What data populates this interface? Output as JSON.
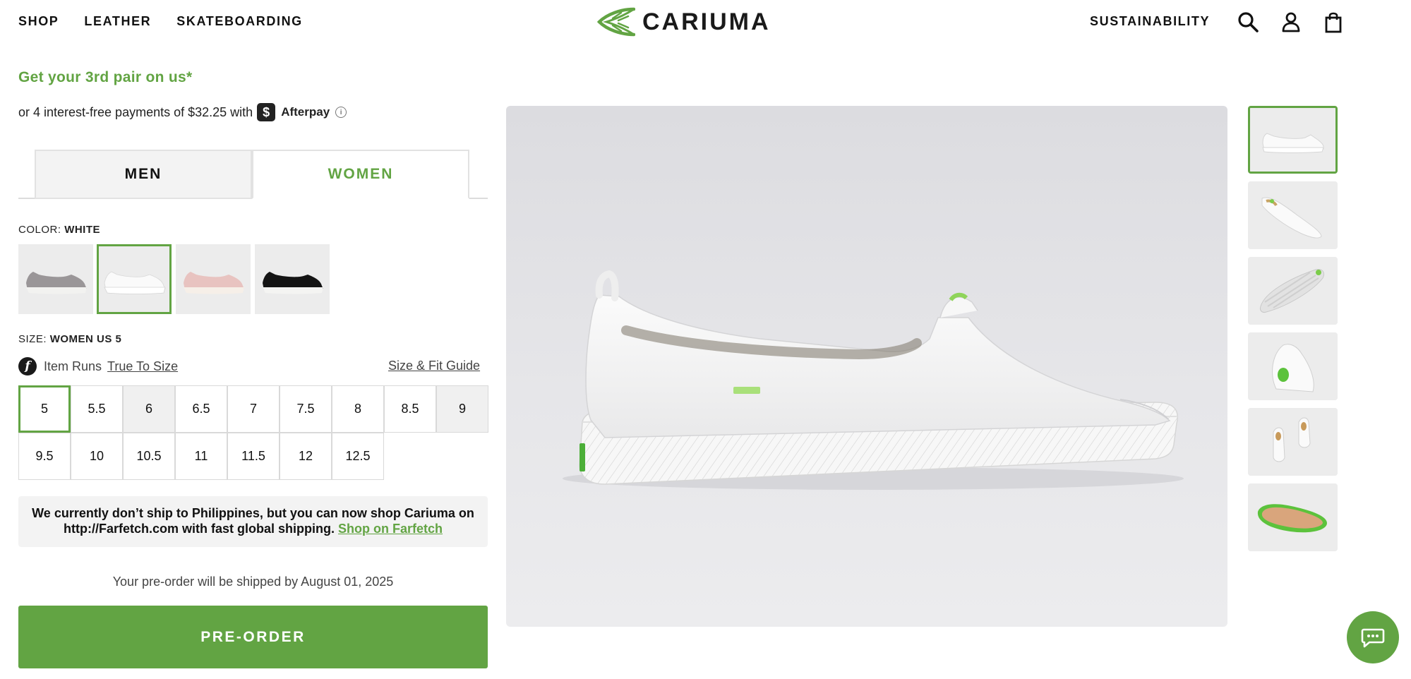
{
  "header": {
    "nav_left": [
      "SHOP",
      "LEATHER",
      "SKATEBOARDING"
    ],
    "brand": "CARIUMA",
    "nav_right": "SUSTAINABILITY",
    "icons": [
      "search-icon",
      "account-icon",
      "bag-icon"
    ]
  },
  "promo": "Get your 3rd pair on us*",
  "afterpay": {
    "text": "or 4 interest-free payments of $32.25 with",
    "badge": "$",
    "name": "Afterpay",
    "info": "i"
  },
  "gender_tabs": {
    "men": "MEN",
    "women": "WOMEN",
    "selected": "women"
  },
  "color": {
    "label": "COLOR:",
    "value": "WHITE",
    "swatches": [
      {
        "name": "grey",
        "shoe": "#9a9698",
        "sole": "#f2f2f0"
      },
      {
        "name": "white",
        "shoe": "#f4f4f4",
        "sole": "#ffffff",
        "selected": true
      },
      {
        "name": "pink",
        "shoe": "#e8c3c0",
        "sole": "#f6efe8"
      },
      {
        "name": "black",
        "shoe": "#141414",
        "sole": "#f4f4f2"
      }
    ]
  },
  "size": {
    "label": "SIZE:",
    "value": "WOMEN US 5",
    "fit_icon": "f",
    "fit_text": "Item Runs",
    "fit_link": "True To Size",
    "guide_link": "Size & Fit Guide",
    "row1": [
      "5",
      "5.5",
      "6",
      "6.5",
      "7",
      "7.5",
      "8",
      "8.5",
      "9"
    ],
    "row2": [
      "9.5",
      "10",
      "10.5",
      "11",
      "11.5",
      "12",
      "12.5"
    ],
    "unavailable": [
      "6",
      "9"
    ],
    "selected": "5"
  },
  "notice": {
    "text": "We currently don’t ship to Philippines, but you can now shop Cariuma on http://Farfetch.com with fast global shipping.",
    "link": "Shop on Farfetch"
  },
  "preorder_note": "Your pre-order will be shipped by August 01, 2025",
  "preorder_button": "PRE-ORDER",
  "colors": {
    "accent": "#62a443",
    "text": "#1a1a1a",
    "panel": "#f3f3f3"
  },
  "thumbnails": [
    "side-view",
    "top-view",
    "sole-view",
    "heel-view",
    "pair-view",
    "insole-view"
  ],
  "chat_icon": "chat-bubble-icon"
}
